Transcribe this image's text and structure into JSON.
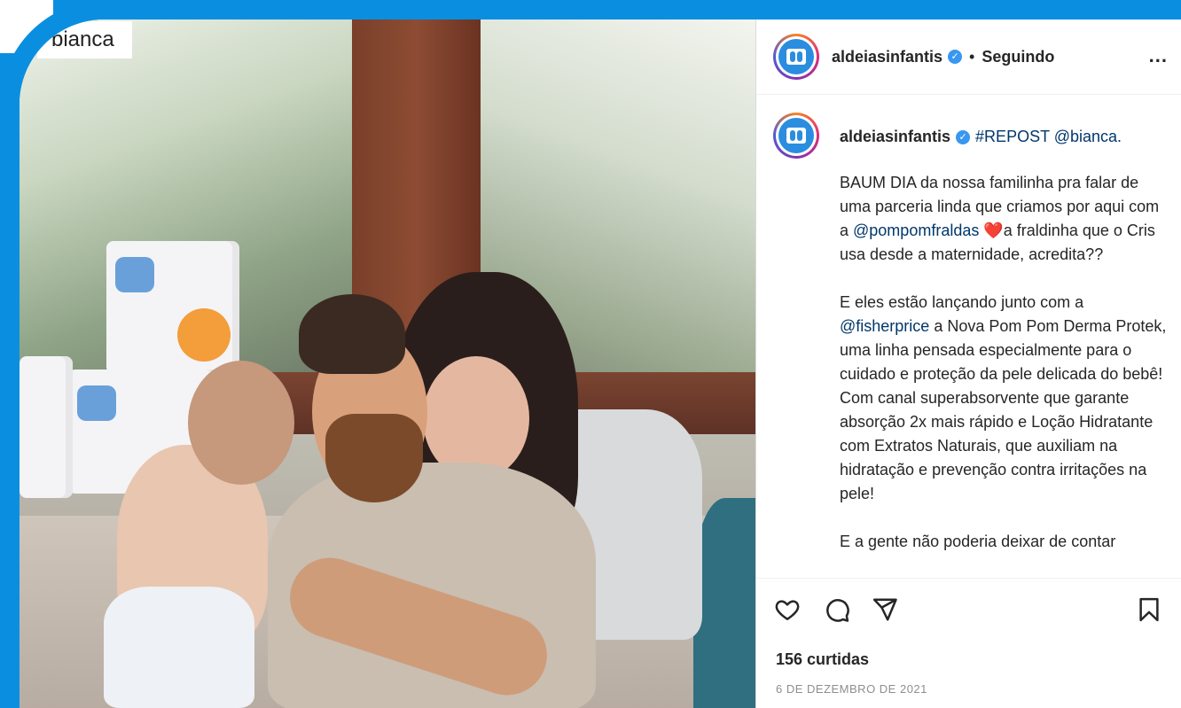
{
  "photo": {
    "tag_label": "bianca"
  },
  "header": {
    "username": "aldeiasinfantis",
    "separator": "•",
    "follow_state": "Seguindo",
    "more_label": "..."
  },
  "caption": {
    "username": "aldeiasinfantis",
    "repost_tag": "#REPOST @bianca.",
    "paragraphs": [
      {
        "parts": [
          {
            "text": "BAUM DIA da nossa familinha pra falar de uma parceria linda que criamos por aqui com a ",
            "type": "text"
          },
          {
            "text": "@pompomfraldas",
            "type": "mention"
          },
          {
            "text": " ❤️",
            "type": "emoji"
          },
          {
            "text": "a fraldinha que o Cris usa desde a maternidade, acredita??",
            "type": "text"
          }
        ]
      },
      {
        "parts": [
          {
            "text": "E eles estão lançando junto com a ",
            "type": "text"
          },
          {
            "text": "@fisherprice",
            "type": "mention"
          },
          {
            "text": " a Nova Pom Pom Derma Protek, uma linha pensada especialmente para o cuidado e proteção da pele delicada do bebê! Com canal superabsorvente que garante absorção 2x mais rápido e Loção Hidratante com Extratos Naturais, que auxiliam na hidratação e prevenção contra irritações na pele!",
            "type": "text"
          }
        ]
      },
      {
        "parts": [
          {
            "text": "E a gente não poderia deixar de contar",
            "type": "text"
          }
        ]
      }
    ]
  },
  "actions": {
    "like_icon": "heart-outline-icon",
    "comment_icon": "comment-bubble-icon",
    "share_icon": "send-paper-plane-icon",
    "save_icon": "bookmark-outline-icon"
  },
  "likes_text": "156 curtidas",
  "date_text": "6 DE DEZEMBRO DE 2021",
  "colors": {
    "frame_blue": "#0a8fe0",
    "mention_blue": "#00376b",
    "verified_blue": "#3897f0",
    "date_gray": "#8e8e8e"
  }
}
